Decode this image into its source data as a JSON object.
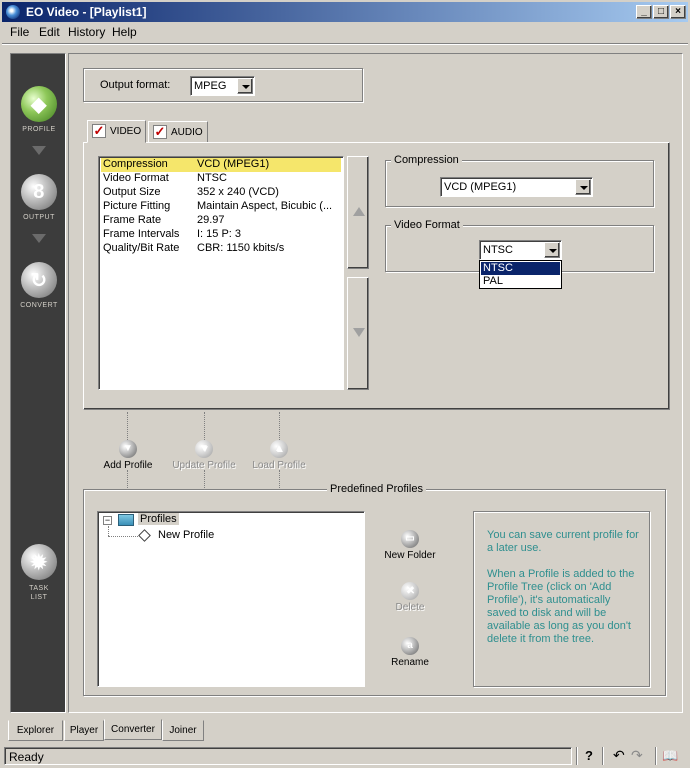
{
  "window": {
    "title": "EO Video - [Playlist1]",
    "min": "_",
    "max": "□",
    "close": "×"
  },
  "menu": [
    {
      "label": "File"
    },
    {
      "label": "Edit"
    },
    {
      "label": "History"
    },
    {
      "label": "Help"
    }
  ],
  "sidebar": {
    "profile": "PROFILE",
    "output": "OUTPUT",
    "convert": "CONVERT",
    "tasklist": "TASK LIST"
  },
  "output_format": {
    "label": "Output format:",
    "value": "MPEG"
  },
  "tabs": {
    "video": "VIDEO",
    "audio": "AUDIO"
  },
  "properties": [
    {
      "key": "Compression",
      "value": "VCD (MPEG1)"
    },
    {
      "key": "Video Format",
      "value": "NTSC"
    },
    {
      "key": "Output Size",
      "value": "352 x 240 (VCD)"
    },
    {
      "key": "Picture Fitting",
      "value": "Maintain Aspect, Bicubic (..."
    },
    {
      "key": "Frame Rate",
      "value": "29.97"
    },
    {
      "key": "Frame Intervals",
      "value": "I: 15    P: 3"
    },
    {
      "key": "Quality/Bit Rate",
      "value": "CBR: 1150 kbits/s"
    }
  ],
  "compression": {
    "title": "Compression",
    "value": "VCD (MPEG1)"
  },
  "video_format": {
    "title": "Video Format",
    "value": "NTSC",
    "options": [
      "NTSC",
      "PAL"
    ]
  },
  "profile_actions": {
    "add": "Add Profile",
    "update": "Update Profile",
    "load": "Load Profile"
  },
  "predefined": {
    "title": "Predefined Profiles",
    "tree_root": "Profiles",
    "tree_child": "New Profile",
    "new_folder": "New Folder",
    "delete": "Delete",
    "rename": "Rename",
    "info1": "You can save current profile for a later use.",
    "info2": "When a Profile is added to the Profile Tree (click on 'Add Profile'), it's automatically saved to disk and will be available as long as you don't delete it from the tree."
  },
  "bottom_tabs": [
    "Explorer",
    "Player",
    "Converter",
    "Joiner"
  ],
  "status": {
    "text": "Ready",
    "help": "?"
  }
}
